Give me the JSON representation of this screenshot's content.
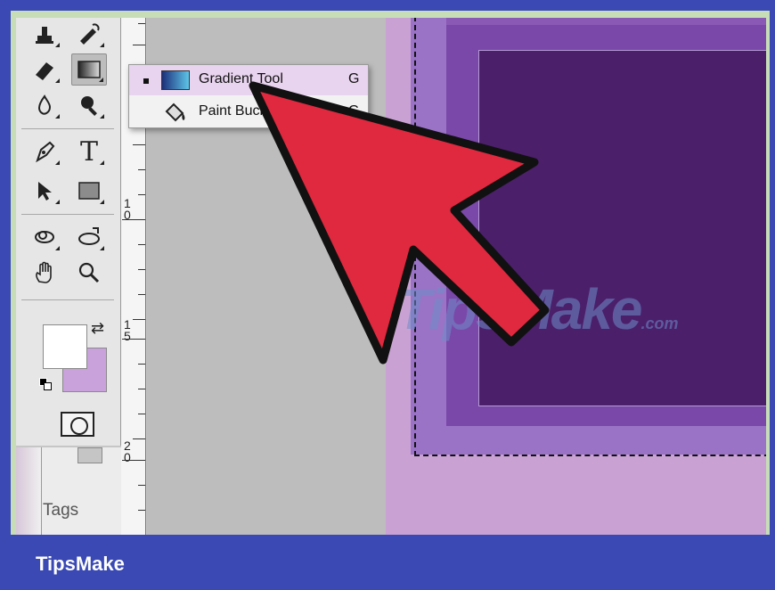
{
  "flyout_menu": {
    "items": [
      {
        "label": "Gradient Tool",
        "shortcut": "G",
        "selected": true,
        "icon": "gradient-icon"
      },
      {
        "label": "Paint Bucket Tool",
        "shortcut": "G",
        "selected": false,
        "icon": "paint-bucket-icon"
      }
    ]
  },
  "tools": {
    "stamp": "stamp-icon",
    "history_brush": "history-brush-icon",
    "eraser": "eraser-icon",
    "gradient": "gradient-icon",
    "blur": "blur-icon",
    "burn": "burn-icon",
    "pen": "pen-icon",
    "type_glyph": "T",
    "path_select": "path-select-icon",
    "shape": "rectangle-shape-icon",
    "rotate_3d": "3d-rotate-icon",
    "orbit_3d": "3d-orbit-icon",
    "hand": "hand-icon",
    "zoom": "zoom-icon"
  },
  "colors": {
    "foreground": "#ffffff",
    "background": "#c9a2dc",
    "canvas_dark": "#4b1f6a",
    "canvas_mid": "#7a48a8",
    "canvas_light": "#c9a2d3",
    "arrow": "#e0283e",
    "brand_bar": "#3a49b4"
  },
  "ruler": {
    "labels": [
      "1 0",
      "1 5",
      "2 0"
    ]
  },
  "panel": {
    "tags_label": "Tags"
  },
  "watermark": {
    "main": "TipsMake",
    "suffix": ".com"
  },
  "brand": {
    "name": "TipsMake"
  }
}
